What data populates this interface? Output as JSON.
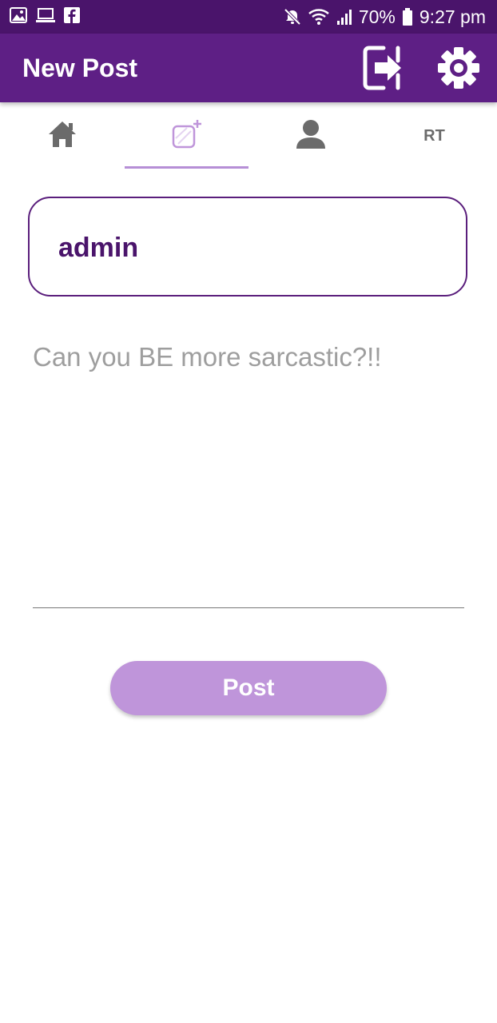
{
  "status_bar": {
    "battery_percent": "70%",
    "time": "9:27 pm",
    "icons_left": [
      "gallery-icon",
      "laptop-icon",
      "facebook-icon"
    ],
    "icons_right": [
      "mute-icon",
      "wifi-icon",
      "signal-icon",
      "battery-icon"
    ]
  },
  "app_bar": {
    "title": "New Post",
    "actions": [
      "logout-icon",
      "gear-icon"
    ]
  },
  "tabs": {
    "items": [
      {
        "id": "home",
        "icon": "home-icon"
      },
      {
        "id": "new-post",
        "icon": "add-post-icon",
        "selected": true
      },
      {
        "id": "profile",
        "icon": "person-icon"
      },
      {
        "id": "rt",
        "label": "RT"
      }
    ]
  },
  "post_form": {
    "username": "admin",
    "input_placeholder": "Can you BE more sarcastic?!!",
    "input_value": "",
    "submit_label": "Post"
  },
  "colors": {
    "status_bar": "#4a146b",
    "app_bar": "#5e1f85",
    "accent_light": "#bf95da",
    "border": "#5a1e7c"
  }
}
